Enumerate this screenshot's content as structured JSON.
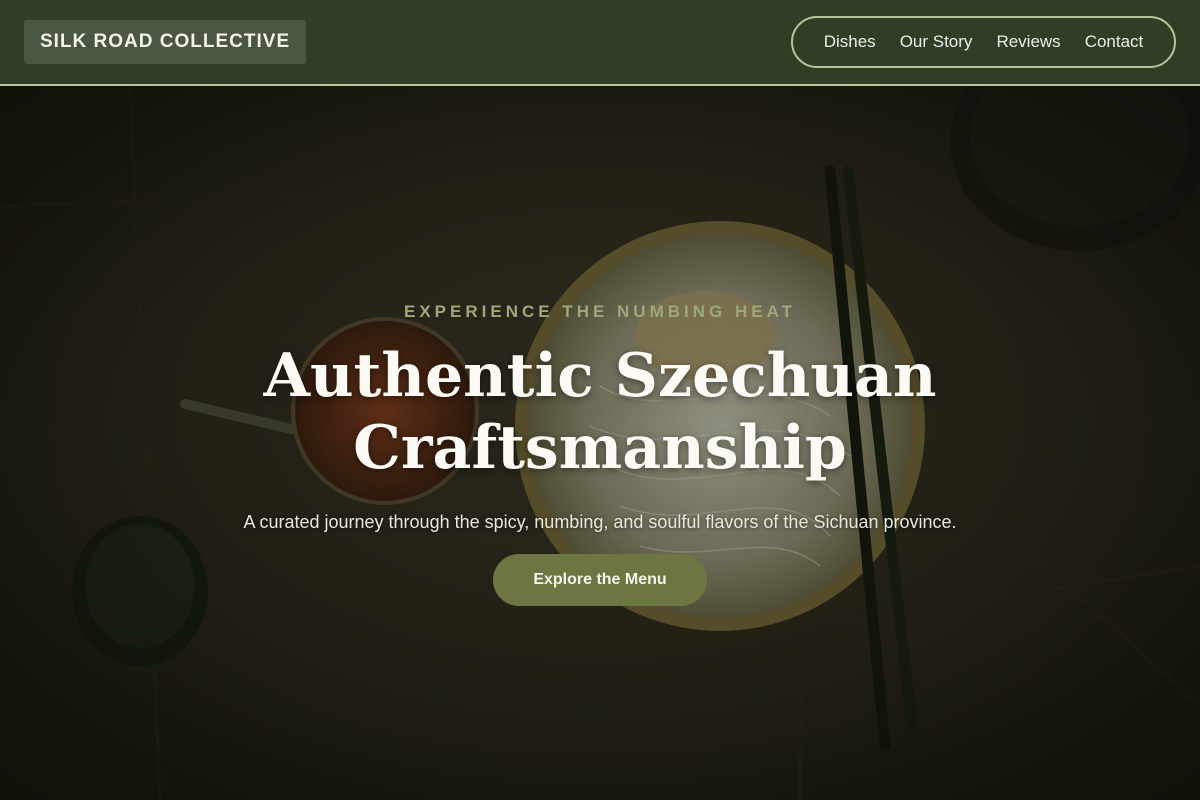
{
  "header": {
    "logo": "SILK ROAD COLLECTIVE",
    "nav": [
      {
        "label": "Dishes"
      },
      {
        "label": "Our Story"
      },
      {
        "label": "Reviews"
      },
      {
        "label": "Contact"
      }
    ]
  },
  "hero": {
    "eyebrow": "EXPERIENCE THE NUMBING HEAT",
    "headline_line1": "Authentic Szechuan",
    "headline_line2": "Craftsmanship",
    "subtitle": "A curated journey through the spicy, numbing, and soulful flavors of the Sichuan province.",
    "cta_label": "Explore the Menu"
  },
  "colors": {
    "header_bg": "#2f3e24",
    "accent_border": "#b7c39b",
    "eyebrow": "#9ea87a",
    "cta_bg": "#6c7643"
  }
}
